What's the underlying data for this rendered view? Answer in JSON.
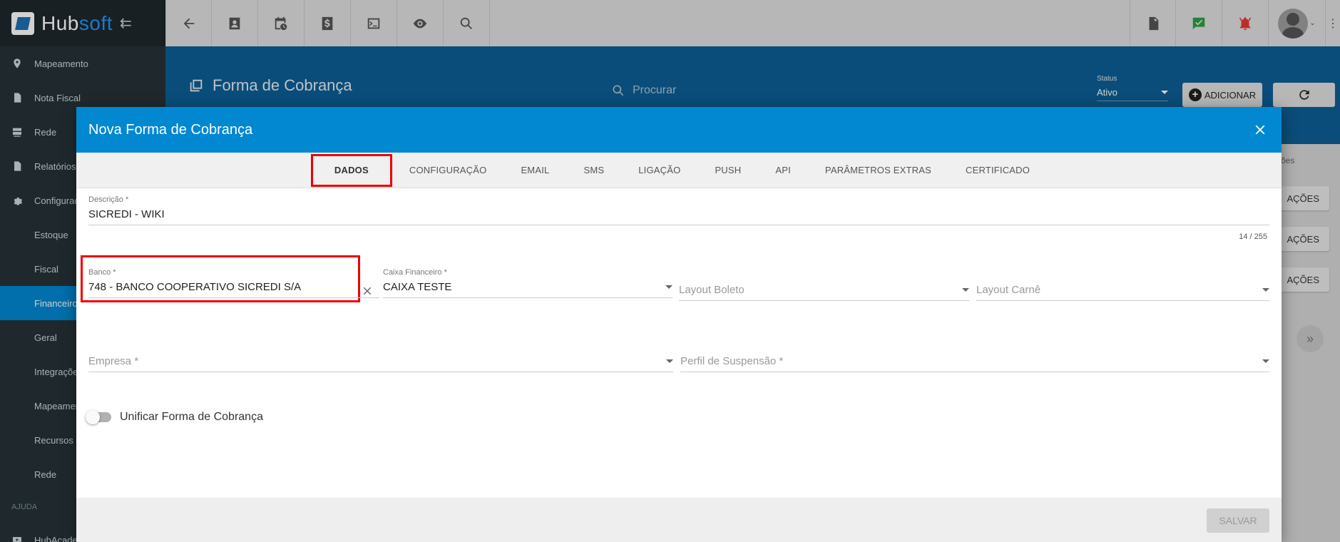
{
  "app": {
    "brand_part1": "Hub",
    "brand_part2": "soft"
  },
  "sidebar": {
    "items": [
      {
        "label": "Mapeamento",
        "icon": "map-pin-icon"
      },
      {
        "label": "Nota Fiscal",
        "icon": "document-icon"
      },
      {
        "label": "Rede",
        "icon": "server-icon"
      },
      {
        "label": "Relatórios",
        "icon": "report-icon"
      },
      {
        "label": "Configurações",
        "icon": "gear-icon"
      },
      {
        "label": "Estoque"
      },
      {
        "label": "Fiscal"
      },
      {
        "label": "Financeiro"
      },
      {
        "label": "Geral"
      },
      {
        "label": "Integrações"
      },
      {
        "label": "Mapeamento"
      },
      {
        "label": "Recursos Extras"
      },
      {
        "label": "Rede"
      }
    ],
    "section_help": "AJUDA",
    "help_item": "HubAcademy"
  },
  "page": {
    "title": "Forma de Cobrança",
    "search_placeholder": "Procurar",
    "status_label": "Status",
    "status_value": "Ativo",
    "add_label": "ADICIONAR",
    "column_header_fragment": "ções",
    "row_action_fragment": "AÇÕES"
  },
  "modal": {
    "title": "Nova Forma de Cobrança",
    "tabs": [
      "DADOS",
      "CONFIGURAÇÃO",
      "EMAIL",
      "SMS",
      "LIGAÇÃO",
      "PUSH",
      "API",
      "PARÂMETROS EXTRAS",
      "CERTIFICADO"
    ],
    "active_tab": "DADOS",
    "descricao": {
      "label": "Descrição *",
      "value": "SICREDI - WIKI",
      "counter": "14 / 255"
    },
    "banco": {
      "label": "Banco *",
      "value": "748 - BANCO COOPERATIVO SICREDI S/A"
    },
    "caixa": {
      "label": "Caixa Financeiro *",
      "value": "CAIXA TESTE"
    },
    "layout_boleto": {
      "placeholder": "Layout Boleto"
    },
    "layout_carne": {
      "placeholder": "Layout Carnê"
    },
    "empresa": {
      "placeholder": "Empresa *"
    },
    "perfil": {
      "placeholder": "Perfil de Suspensão *"
    },
    "unificar": {
      "label": "Unificar Forma de Cobrança",
      "checked": false
    },
    "save_label": "SALVAR"
  },
  "colors": {
    "accent": "#0288d1",
    "sidebar": "#263238",
    "highlight": "#ee0000"
  }
}
